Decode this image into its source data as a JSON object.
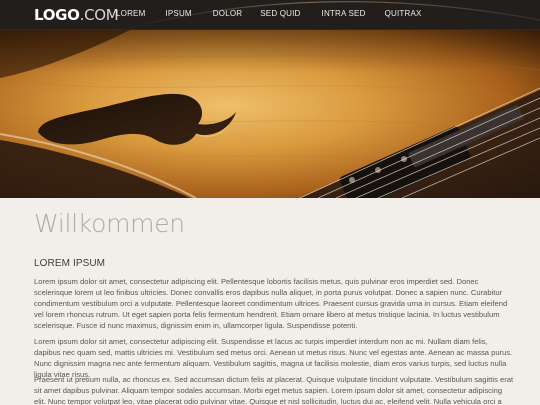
{
  "header": {
    "logo_bold": "LOGO",
    "logo_light": ".COM",
    "nav": [
      {
        "label": "LOREM"
      },
      {
        "label": "IPSUM"
      },
      {
        "label": "DOLOR"
      },
      {
        "label": "SED QUID"
      },
      {
        "label": "INTRA SED"
      },
      {
        "label": "QUITRAX"
      }
    ]
  },
  "hero": {
    "image": "guitar-hollow-body-closeup"
  },
  "main": {
    "title": "Willkommen",
    "section_title": "LOREM IPSUM",
    "paragraphs": [
      "Lorem ipsum dolor sit amet, consectetur adipiscing elit. Pellentesque lobortis facilisis metus, quis pulvinar eros imperdiet sed. Donec scelerisque lorem ut leo finibus ultricies. Donec convallis eros dapibus nulla aliquet, in porta purus volutpat. Donec a sapien nunc. Curabitur condimentum vestibulum orci a vulputate. Pellentesque laoreet condimentum ultrices. Praesent cursus gravida urna in cursus. Etiam eleifend vel lorem rhoncus rutrum. Ut eget sapien porta felis fermentum hendrerit. Etiam ornare libero at metus tristique lacinia. In luctus vestibulum scelerisque. Fusce id nunc maximus, dignissim enim in, ullamcorper ligula. Suspendisse potenti.",
      "Lorem ipsum dolor sit amet, consectetur adipiscing elit. Suspendisse et lacus ac turpis imperdiet interdum non ac mi. Nullam diam felis, dapibus nec quam sed, mattis ultricies mi. Vestibulum sed metus orci. Aenean ut metus risus. Nunc vel egestas ante. Aenean ac massa purus. Nunc dignissim magna nec ante fermentum aliquam. Vestibulum sagittis, magna ut facilisis molestie, diam eros varius turpis, sed luctus nulla ligula vitae risus.",
      "Praesent ut pretium nulla, ac rhoncus ex. Sed accumsan dictum felis at placerat. Quisque vulputate tincidunt vulputate. Vestibulum sagittis erat sit amet dapibus pulvinar. Aliquam tempor sodales accumsan. Morbi eget metus sapien. Lorem ipsum dolor sit amet, consectetur adipiscing elit. Nunc tempor volutpat leo, vitae placerat odio pulvinar vitae. Quisque et nisl sollicitudin, luctus dui ac, eleifend velit. Nulla vehicula orci a erat sollicitudin consectetur."
    ]
  },
  "colors": {
    "navbar_bg": "#211e1c",
    "page_bg": "#f2eeea",
    "title": "#b0aaa4",
    "body_text": "#595653"
  }
}
